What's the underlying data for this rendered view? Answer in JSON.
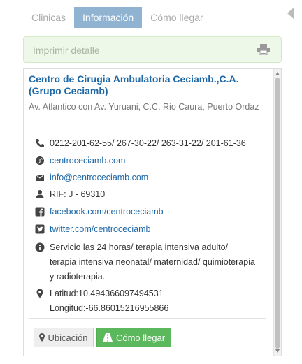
{
  "tabs": [
    "Clinicas",
    "Información",
    "Cómo llegar"
  ],
  "active_tab": "Información",
  "print": {
    "label": "Imprimir detalle",
    "icon": "printer-icon"
  },
  "clinic": {
    "name": "Centro de Cirugia Ambulatoria Ceciamb.,C.A. (Grupo Ceciamb)",
    "address": "Av. Atlantico con Av. Yuruani, C.C. Rio Caura, Puerto Ordaz"
  },
  "details": {
    "phone": "0212-201-62-55/ 267-30-22/ 263-31-22/ 201-61-36",
    "website": "centroceciamb.com",
    "email": "info@centroceciamb.com",
    "rif": "RIF: J - 69310",
    "facebook": "facebook.com/centroceciamb",
    "twitter": "twitter.com/centroceciamb",
    "services_line1": "Servicio las 24 horas/ terapia intensiva adulto/",
    "services_line2": "terapia intensiva neonatal/ maternidad/ quimioterapia",
    "services_line3": "y radioterapia.",
    "latitude": "Latitud:10.494366097494531",
    "longitude": "Longitud:-66.86015216955866"
  },
  "buttons": {
    "location": "Ubicación",
    "directions": "Cómo llegar"
  },
  "colors": {
    "link": "#1d67a6",
    "active_tab": "#8fb3d0",
    "print_bg": "#eef8e9",
    "success": "#5cb85c"
  }
}
